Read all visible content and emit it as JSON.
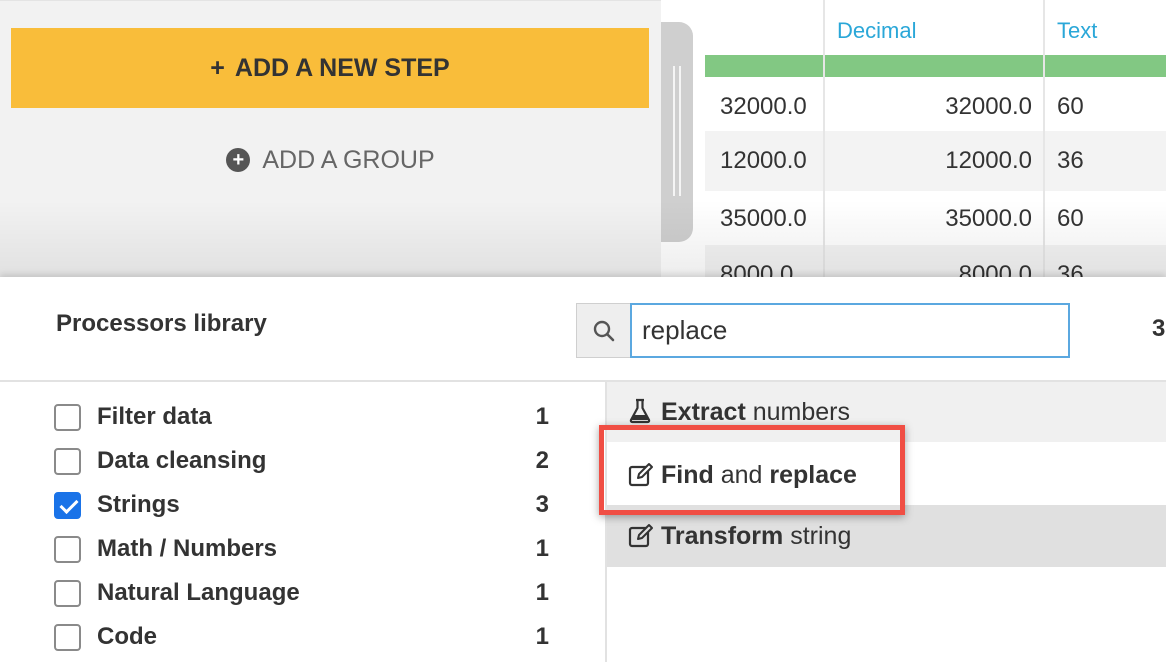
{
  "steps": {
    "add_step_label": "ADD A NEW STEP",
    "add_group_label": "ADD A GROUP"
  },
  "table": {
    "columns": [
      {
        "type": ""
      },
      {
        "type": "Decimal"
      },
      {
        "type": "Text"
      }
    ],
    "rows": [
      [
        "32000.0",
        "32000.0",
        "60"
      ],
      [
        "12000.0",
        "12000.0",
        "36"
      ],
      [
        "35000.0",
        "35000.0",
        "60"
      ],
      [
        "8000.0",
        "8000.0",
        "36"
      ]
    ]
  },
  "library": {
    "title": "Processors library",
    "search_value": "replace",
    "result_count": "3",
    "categories": [
      {
        "label": "Filter data",
        "count": "1",
        "checked": false
      },
      {
        "label": "Data cleansing",
        "count": "2",
        "checked": false
      },
      {
        "label": "Strings",
        "count": "3",
        "checked": true
      },
      {
        "label": "Math / Numbers",
        "count": "1",
        "checked": false
      },
      {
        "label": "Natural Language",
        "count": "1",
        "checked": false
      },
      {
        "label": "Code",
        "count": "1",
        "checked": false
      }
    ],
    "results": [
      {
        "bold": "Extract",
        "rest": " numbers",
        "icon": "flask-icon"
      },
      {
        "bold": "Find",
        "mid": " and ",
        "bold2": "replace",
        "icon": "edit-icon"
      },
      {
        "bold": "Transform",
        "rest": " string",
        "icon": "edit-icon"
      }
    ]
  },
  "colors": {
    "accent_button": "#f9bd3a",
    "column_type": "#2aa7d8",
    "quality_bar": "#82c883",
    "highlight": "#f04e44",
    "checkbox": "#1a73e8"
  }
}
